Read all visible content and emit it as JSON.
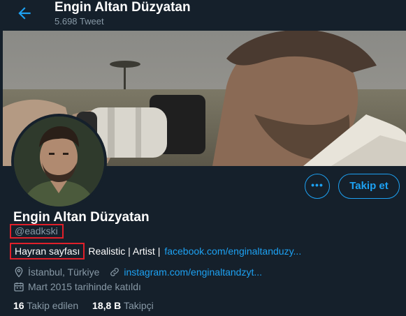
{
  "header": {
    "title": "Engin Altan Düzyatan",
    "tweet_count": "5.698 Tweet"
  },
  "actions": {
    "more_label": "•••",
    "follow_label": "Takip et"
  },
  "profile": {
    "name": "Engin Altan Düzyatan",
    "handle": "@eadkski",
    "bio_highlight": "Hayran sayfası",
    "bio_text": "Realistic | Artist |",
    "bio_link": "facebook.com/enginaltanduzy...",
    "location": "İstanbul, Türkiye",
    "website": "instagram.com/enginaltandzyt...",
    "joined": "Mart 2015 tarihinde katıldı"
  },
  "stats": {
    "following_count": "16",
    "following_label": "Takip edilen",
    "followers_count": "18,8 B",
    "followers_label": "Takipçi"
  },
  "icons": {
    "back": "arrow-left-icon",
    "location": "map-pin-icon",
    "link": "link-icon",
    "calendar": "calendar-icon"
  },
  "colors": {
    "background": "#15202b",
    "accent": "#1da1f2",
    "muted": "#8899a6",
    "highlight_box": "#e0202a"
  }
}
